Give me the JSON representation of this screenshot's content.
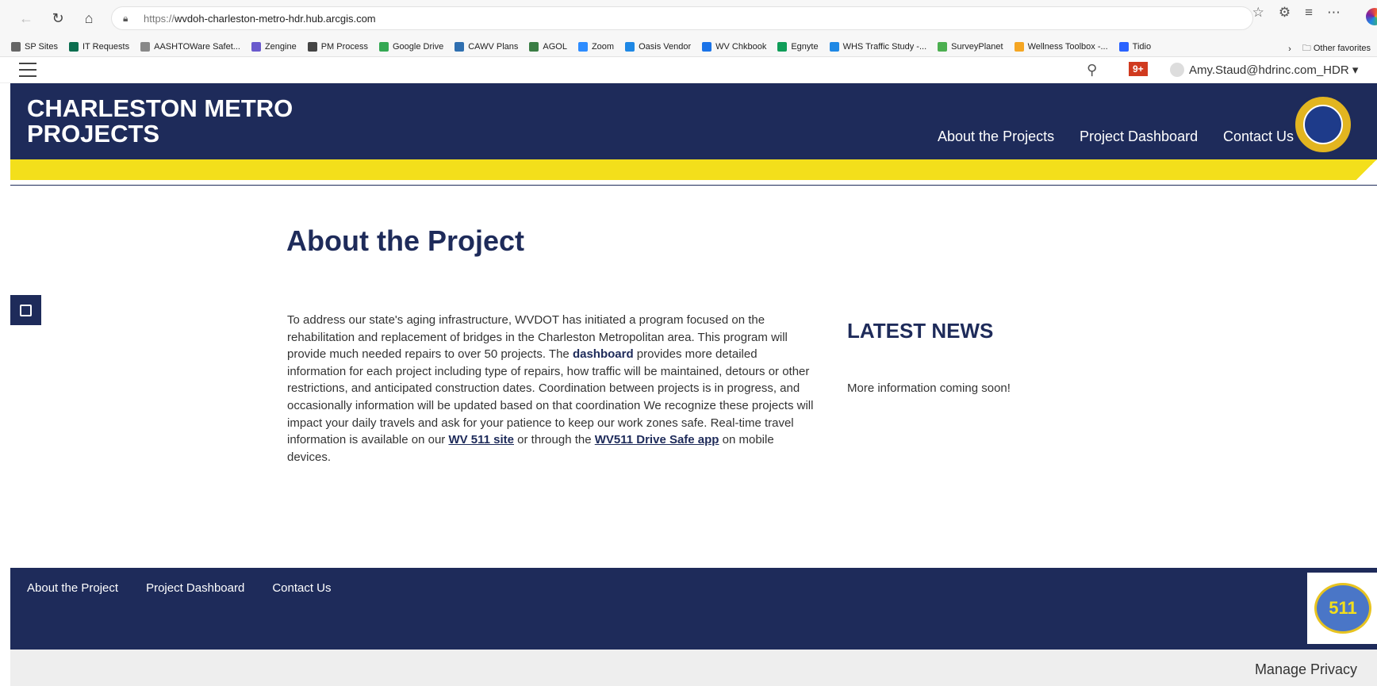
{
  "browser": {
    "url_scheme": "https://",
    "url_host": "wvdoh-charleston-metro-hdr.hub.arcgis.com",
    "bookmarks": [
      {
        "label": "SP Sites",
        "color": "#666666"
      },
      {
        "label": "IT Requests",
        "color": "#0b6e4f"
      },
      {
        "label": "AASHTOWare Safet...",
        "color": "#888888"
      },
      {
        "label": "Zengine",
        "color": "#6a5acd"
      },
      {
        "label": "PM Process",
        "color": "#444444"
      },
      {
        "label": "Google Drive",
        "color": "#34a853"
      },
      {
        "label": "CAWV Plans",
        "color": "#2f6fb0"
      },
      {
        "label": "AGOL",
        "color": "#3a7d44"
      },
      {
        "label": "Zoom",
        "color": "#2d8cff"
      },
      {
        "label": "Oasis Vendor",
        "color": "#1e88e5"
      },
      {
        "label": "WV Chkbook",
        "color": "#1a73e8"
      },
      {
        "label": "Egnyte",
        "color": "#0f9d58"
      },
      {
        "label": "WHS Traffic Study -...",
        "color": "#1e88e5"
      },
      {
        "label": "SurveyPlanet",
        "color": "#4caf50"
      },
      {
        "label": "Wellness Toolbox -...",
        "color": "#f5a623"
      },
      {
        "label": "Tidio",
        "color": "#2962ff"
      }
    ],
    "other_favorites": "Other favorites"
  },
  "app_bar": {
    "notifications": "9+",
    "user": "Amy.Staud@hdrinc.com_HDR"
  },
  "header": {
    "title_line1": "CHARLESTON METRO",
    "title_line2": "PROJECTS",
    "nav": [
      "About the Projects",
      "Project Dashboard",
      "Contact Us"
    ]
  },
  "main": {
    "title": "About the Project",
    "body_1": "To address our state's aging infrastructure, WVDOT has initiated a program focused on the rehabilitation and replacement of bridges in the Charleston Metropolitan area.  This program will provide much needed repairs to over 50 projects. The ",
    "body_link_dashboard": "dashboard",
    "body_2": " provides more detailed information for each project including type of repairs, how traffic will be maintained, detours or other restrictions, and anticipated construction dates.  Coordination between projects is in progress, and occasionally information will be updated based on that coordination  We recognize these projects will impact your daily travels and ask for your patience to keep our work zones safe. Real-time travel information is available on our ",
    "body_link_511": "WV 511 site",
    "body_3": " or through the ",
    "body_link_app": "WV511 Drive Safe app",
    "body_4": " on mobile devices."
  },
  "news": {
    "title": "LATEST NEWS",
    "text": "More information coming soon!"
  },
  "footer": {
    "links": [
      "About the Project",
      "Project Dashboard",
      "Contact Us"
    ],
    "logo_text": "511",
    "privacy": "Manage Privacy"
  },
  "colors": {
    "navy": "#1e2b5a",
    "yellow": "#f3df1b"
  }
}
